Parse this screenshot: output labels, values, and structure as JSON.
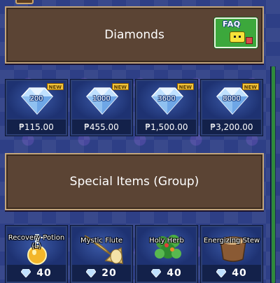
{
  "sections": {
    "diamonds": {
      "title": "Diamonds",
      "faq_label": "FAQ"
    },
    "special": {
      "title": "Special Items (Group)"
    }
  },
  "diamond_packs": [
    {
      "amount": "200",
      "badge": "NEW",
      "price": "₱115.00"
    },
    {
      "amount": "1000",
      "badge": "NEW",
      "price": "₱455.00"
    },
    {
      "amount": "3600",
      "badge": "NEW",
      "price": "₱1,500.00"
    },
    {
      "amount": "8000",
      "badge": "NEW",
      "price": "₱3,200.00"
    }
  ],
  "special_items": [
    {
      "name": "Recovery Potion (L)",
      "icon": "potion-icon",
      "cost": "40"
    },
    {
      "name": "Mystic Flute",
      "icon": "flute-icon",
      "cost": "20"
    },
    {
      "name": "Holy Herb",
      "icon": "herb-icon",
      "cost": "40"
    },
    {
      "name": "Energizing Stew",
      "icon": "stew-icon",
      "cost": "40"
    }
  ],
  "colors": {
    "background": "#2e3f86",
    "header_panel": "#5b4434",
    "faq_button": "#3ca83c",
    "card": "#17295a",
    "badge": "#f2c53a"
  }
}
